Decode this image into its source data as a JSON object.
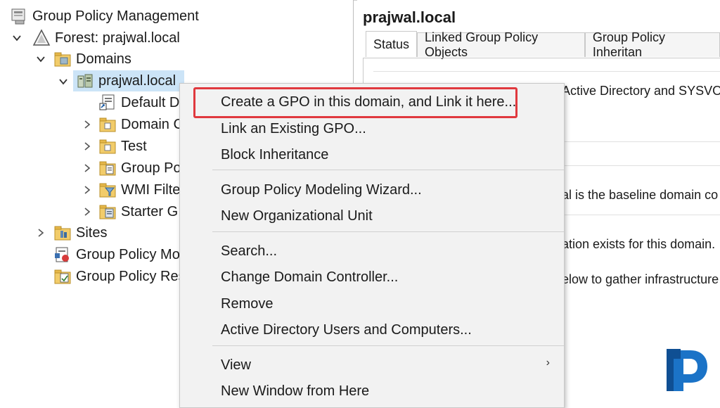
{
  "tree": {
    "root": "Group Policy Management",
    "forest": "Forest: prajwal.local",
    "domains": "Domains",
    "domain": "prajwal.local",
    "children": [
      "Default D",
      "Domain C",
      "Test",
      "Group Po",
      "WMI Filte",
      "Starter G"
    ],
    "sites": "Sites",
    "modeling": "Group Policy Mo",
    "results": "Group Policy Res"
  },
  "right": {
    "title": "prajwal.local",
    "tabs": [
      "Status",
      "Linked Group Policy Objects",
      "Group Policy Inheritan"
    ],
    "fragments": [
      "Active Directory and SYSVOL",
      "al is the baseline domain co",
      "ation exists for this domain.",
      "elow to gather infrastructure"
    ]
  },
  "context_menu": {
    "items": [
      "Create a GPO in this domain, and Link it here...",
      "Link an Existing GPO...",
      "Block Inheritance",
      "Group Policy Modeling Wizard...",
      "New Organizational Unit",
      "Search...",
      "Change Domain Controller...",
      "Remove",
      "Active Directory Users and Computers...",
      "View",
      "New Window from Here"
    ],
    "highlighted_item": "Create a GPO in this domain, and Link it here...",
    "submenu_arrow": "›"
  },
  "colors": {
    "highlight_border": "#e0393e",
    "selection": "#cce4f7",
    "menu_bg": "#f2f2f2",
    "logo_blue": "#1b73c7"
  }
}
